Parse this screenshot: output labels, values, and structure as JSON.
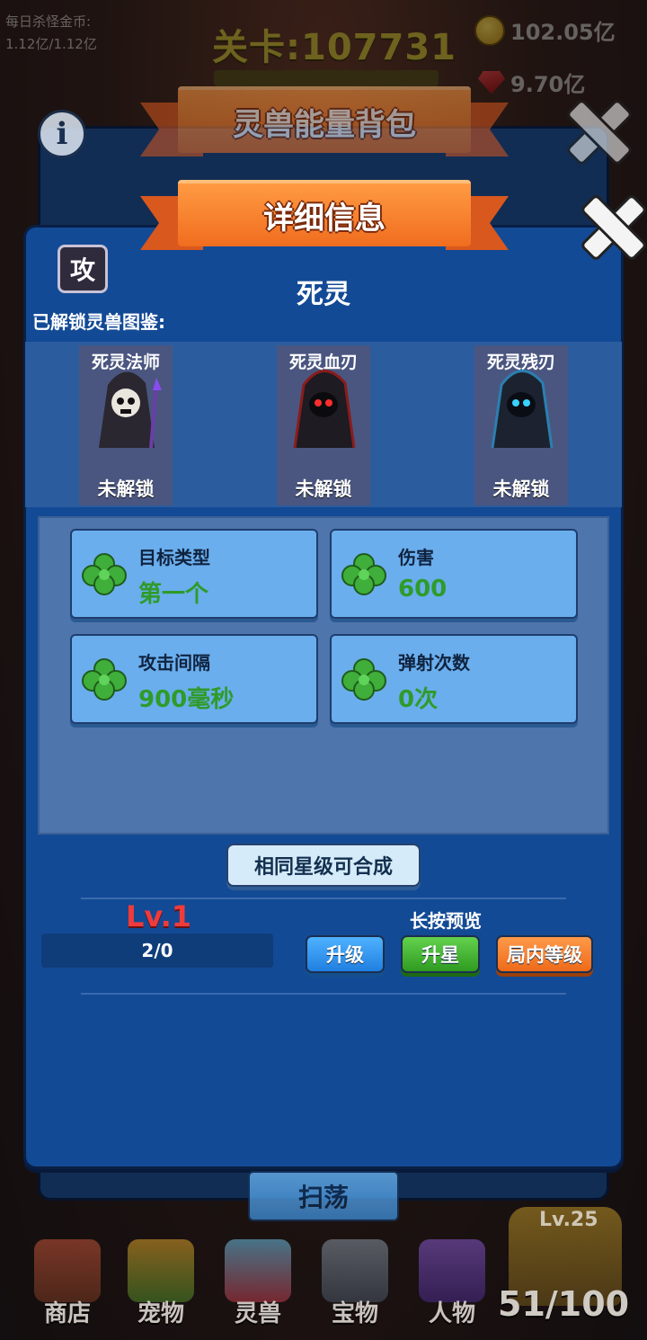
{
  "hud": {
    "daily_gold_label": "每日杀怪金币:",
    "daily_gold_value": "1.12亿/1.12亿",
    "stage_label": "关卡:107731",
    "gold_amount": "102.05亿",
    "gem_amount": "9.70亿"
  },
  "back_panel": {
    "title": "灵兽能量背包"
  },
  "detail": {
    "title": "详细信息",
    "type_badge": "攻",
    "beast_name": "死灵",
    "unlocked_label": "已解锁灵兽图鉴:",
    "cards": [
      {
        "name": "死灵法师",
        "status": "未解锁"
      },
      {
        "name": "死灵血刃",
        "status": "未解锁"
      },
      {
        "name": "死灵残刃",
        "status": "未解锁"
      }
    ],
    "stats": [
      {
        "label": "目标类型",
        "value": "第一个"
      },
      {
        "label": "伤害",
        "value": "600"
      },
      {
        "label": "攻击间隔",
        "value": "900毫秒"
      },
      {
        "label": "弹射次数",
        "value": "0次"
      }
    ],
    "merge_button": "相同星级可合成",
    "level_text": "Lv.1",
    "exp_text": "2/0",
    "preview_label": "长按预览",
    "btn_upgrade": "升级",
    "btn_star": "升星",
    "btn_ingame": "局内等级"
  },
  "sweep_button": "扫荡",
  "nav": [
    {
      "label": "商店",
      "icon": "shop-icon"
    },
    {
      "label": "宠物",
      "icon": "pet-icon"
    },
    {
      "label": "灵兽",
      "icon": "spirit-beast-icon"
    },
    {
      "label": "宝物",
      "icon": "treasure-icon"
    },
    {
      "label": "人物",
      "icon": "character-icon"
    }
  ],
  "chest": {
    "level": "Lv.25",
    "count": "51/100"
  },
  "colors": {
    "panel_blue": "#134a95",
    "stat_card": "#6aaeed",
    "stat_value_green": "#2f9b2a",
    "ribbon_orange": "#f06d1f",
    "level_red": "#ef3b3b"
  }
}
